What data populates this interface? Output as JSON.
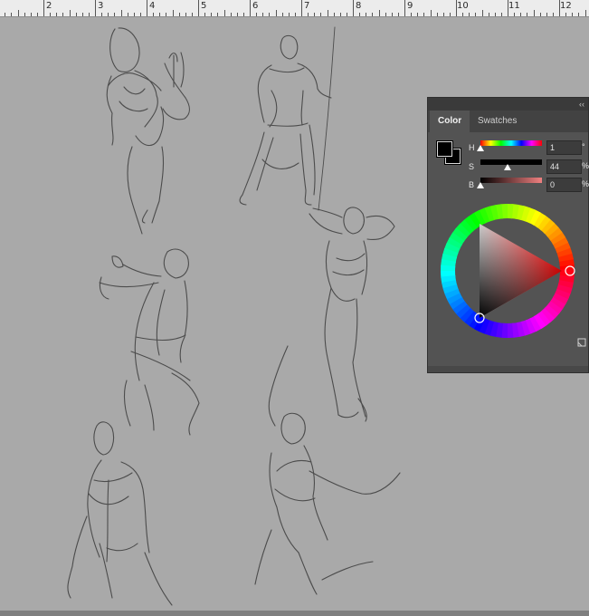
{
  "ruler": {
    "labels": [
      "2",
      "3",
      "4",
      "5",
      "6",
      "7",
      "8",
      "9",
      "10",
      "11",
      "12"
    ]
  },
  "color_panel": {
    "tabs": [
      "Color",
      "Swatches"
    ],
    "active_tab": "Color",
    "collapse_glyph": "‹‹",
    "foreground_color": "#000000",
    "background_color": "#000000",
    "sliders": [
      {
        "label": "H",
        "value": "1",
        "unit": "°",
        "fraction": 0.0
      },
      {
        "label": "S",
        "value": "44",
        "unit": "%",
        "fraction": 0.44
      },
      {
        "label": "B",
        "value": "0",
        "unit": "%",
        "fraction": 0.0
      }
    ],
    "wheel": {
      "hue_degrees": 1,
      "icon": "color-wheel"
    },
    "corner_icon": "panel-options-icon"
  },
  "colors": {
    "canvas": "#a9a9a9",
    "panel": "#535353",
    "sketch_stroke": "#3c3c3c"
  }
}
